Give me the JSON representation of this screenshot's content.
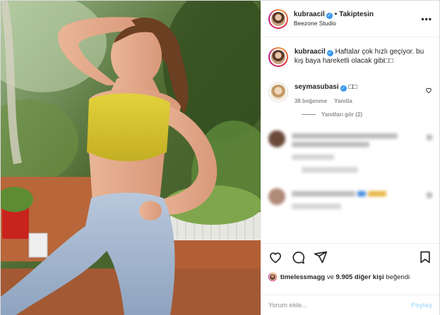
{
  "post": {
    "author": {
      "username": "kubraacil",
      "verified": true,
      "follow_status": "Takiptesin",
      "location": "Beezone Studio"
    },
    "caption": {
      "username": "kubraacil",
      "text": "Haftalar çok hızlı geçiyor. bu kış baya hareketli olacak gibi□□"
    },
    "comments": [
      {
        "username": "seymasubasi",
        "verified": true,
        "text": "□□",
        "likes": "38 beğenme",
        "reply_label": "Yanıtla",
        "view_replies": "Yanıtları gör (2)"
      }
    ],
    "likes_summary": {
      "username": "timelessmagg",
      "connector": "ve",
      "others": "9.905 diğer kişi",
      "suffix": "beğendi"
    },
    "comment_input": {
      "placeholder": "Yorum ekle...",
      "post_label": "Paylaş"
    },
    "icons": {
      "more": "more-options-icon",
      "like": "heart-icon",
      "comment": "comment-icon",
      "share": "share-icon",
      "save": "bookmark-icon",
      "comment_like": "heart-small-icon"
    },
    "colors": {
      "verified_blue": "#3897f0",
      "muted_text": "#8e8e8e",
      "post_button_disabled": "#b2dffc",
      "border": "#efefef"
    }
  }
}
